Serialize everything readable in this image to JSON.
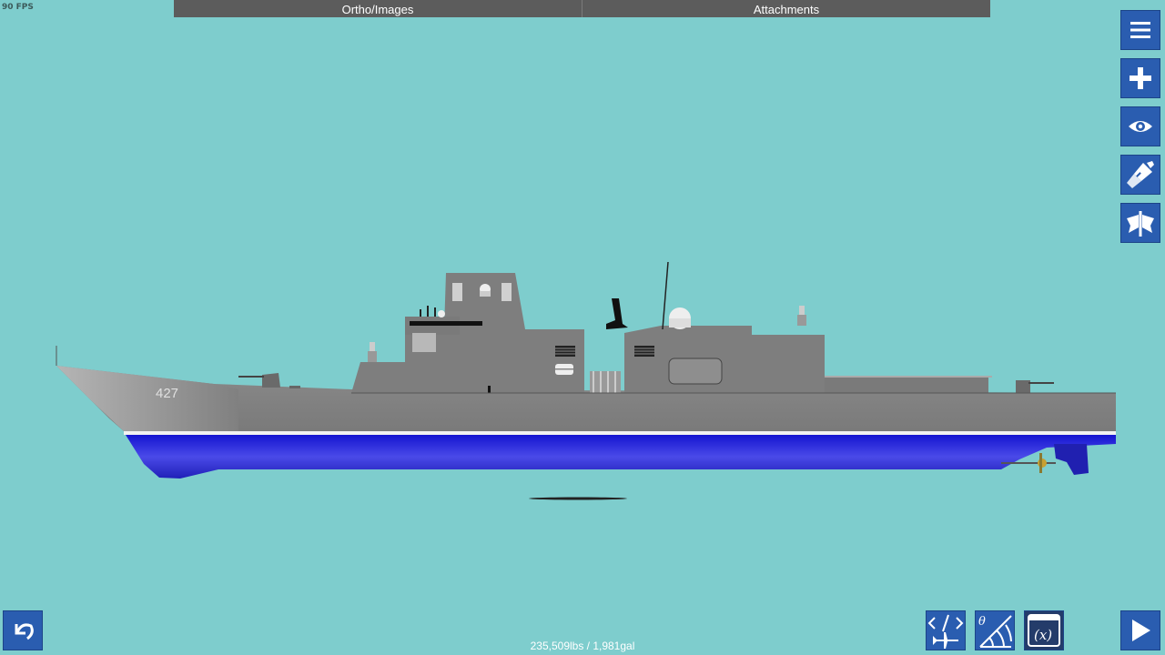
{
  "fps": "90 FPS",
  "tabs": [
    {
      "label": "Ortho/Images"
    },
    {
      "label": "Attachments"
    }
  ],
  "side_buttons": [
    {
      "icon": "menu-icon"
    },
    {
      "icon": "plus-icon"
    },
    {
      "icon": "eye-icon"
    },
    {
      "icon": "paint-brush-icon"
    },
    {
      "icon": "symmetry-icon"
    }
  ],
  "bottom_buttons": {
    "undo": {
      "icon": "undo-icon"
    },
    "code": {
      "icon": "code-airplane-icon"
    },
    "angle": {
      "icon": "angle-theta-icon"
    },
    "variables": {
      "icon": "variables-x-icon"
    },
    "play": {
      "icon": "play-icon"
    }
  },
  "status": "235,509lbs / 1,981gal",
  "ship": {
    "hull_number": "427",
    "colors": {
      "background": "#7ecdcd",
      "hull_gray": "#808080",
      "superstructure_gray": "#7a7a7a",
      "waterline_blue": "#2a2ad8",
      "button_blue": "#2a5db0"
    }
  }
}
